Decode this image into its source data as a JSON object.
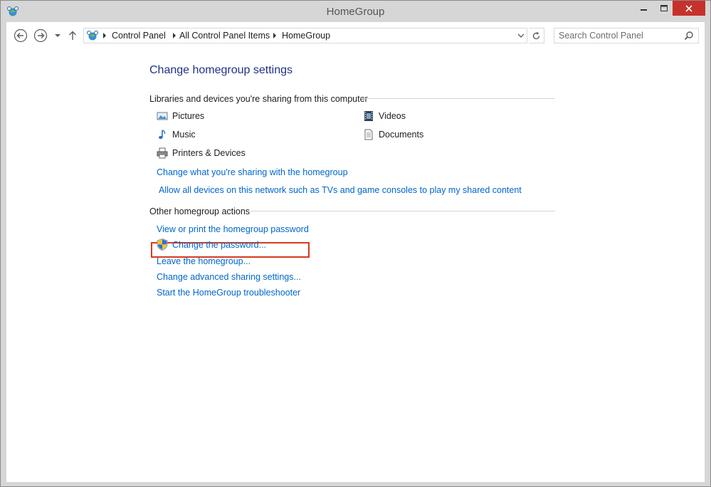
{
  "window": {
    "title": "HomeGroup"
  },
  "navigation": {
    "breadcrumb": [
      "Control Panel",
      "All Control Panel Items",
      "HomeGroup"
    ],
    "search_placeholder": "Search Control Panel"
  },
  "main": {
    "page_title": "Change homegroup settings",
    "sharing_section": {
      "heading": "Libraries and devices you're sharing from this computer",
      "items": [
        {
          "label": "Pictures",
          "icon": "pictures-icon"
        },
        {
          "label": "Videos",
          "icon": "videos-icon"
        },
        {
          "label": "Music",
          "icon": "music-icon"
        },
        {
          "label": "Documents",
          "icon": "documents-icon"
        },
        {
          "label": "Printers & Devices",
          "icon": "printer-icon"
        }
      ],
      "links": [
        "Change what you're sharing with the homegroup",
        "Allow all devices on this network such as TVs and game consoles to play my shared content"
      ]
    },
    "actions_section": {
      "heading": "Other homegroup actions",
      "links": [
        "View or print the homegroup password",
        "Change the password...",
        "Leave the homegroup...",
        "Change advanced sharing settings...",
        "Start the HomeGroup troubleshooter"
      ]
    }
  },
  "colors": {
    "link": "#0066cc",
    "title": "#1e3287",
    "close_button": "#c7312b",
    "highlight": "#d9391f"
  }
}
